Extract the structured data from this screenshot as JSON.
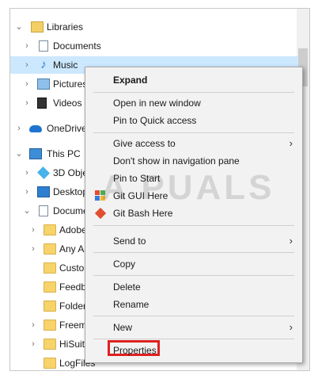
{
  "tree": {
    "items": [
      {
        "label": "Libraries",
        "chevron": "v",
        "icon": "library-icon"
      },
      {
        "label": "Documents",
        "chevron": ">",
        "icon": "documents-icon"
      },
      {
        "label": "Music",
        "chevron": ">",
        "icon": "music-icon"
      },
      {
        "label": "Pictures",
        "chevron": ">",
        "icon": "pictures-icon"
      },
      {
        "label": "Videos",
        "chevron": ">",
        "icon": "videos-icon"
      },
      {
        "label": "OneDrive",
        "chevron": ">",
        "icon": "onedrive-icon"
      },
      {
        "label": "This PC",
        "chevron": "v",
        "icon": "this-pc-icon"
      },
      {
        "label": "3D Obje",
        "chevron": ">",
        "icon": "3d-objects-icon"
      },
      {
        "label": "Desktop",
        "chevron": ">",
        "icon": "desktop-icon"
      },
      {
        "label": "Docume",
        "chevron": "v",
        "icon": "documents-folder-icon"
      },
      {
        "label": "Adobe",
        "chevron": ">",
        "icon": "folder-icon"
      },
      {
        "label": "Any A",
        "chevron": ">",
        "icon": "folder-icon"
      },
      {
        "label": "Custo",
        "chevron": "",
        "icon": "folder-icon"
      },
      {
        "label": "Feedb",
        "chevron": "",
        "icon": "folder-icon"
      },
      {
        "label": "Folder",
        "chevron": "",
        "icon": "folder-icon"
      },
      {
        "label": "Freem",
        "chevron": ">",
        "icon": "folder-icon"
      },
      {
        "label": "HiSuit",
        "chevron": ">",
        "icon": "folder-icon"
      },
      {
        "label": "LogFiles",
        "chevron": "",
        "icon": "folder-icon"
      }
    ]
  },
  "context_menu": {
    "expand": "Expand",
    "open_new_window": "Open in new window",
    "pin_quick_access": "Pin to Quick access",
    "give_access": "Give access to",
    "dont_show_nav": "Don't show in navigation pane",
    "pin_start": "Pin to Start",
    "git_gui": "Git GUI Here",
    "git_bash": "Git Bash Here",
    "send_to": "Send to",
    "copy": "Copy",
    "delete": "Delete",
    "rename": "Rename",
    "new": "New",
    "properties": "Properties",
    "submenu_arrow": "›"
  },
  "watermark": "A PUALS",
  "colors": {
    "selection": "#cce8ff",
    "highlight_box": "#e02020",
    "menu_bg": "#f2f2f2"
  }
}
